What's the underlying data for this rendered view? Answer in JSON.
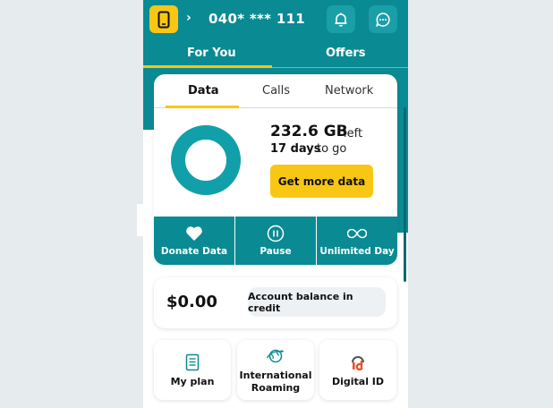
{
  "header": {
    "chevron": "›",
    "phone_number": "040* *** 111",
    "icons": [
      "phone-icon",
      "bell-icon",
      "chat-icon"
    ]
  },
  "main_tabs": [
    {
      "label": "For You",
      "active": true
    },
    {
      "label": "Offers",
      "active": false
    }
  ],
  "usage_tabs": [
    {
      "label": "Data",
      "active": true
    },
    {
      "label": "Calls",
      "active": false
    },
    {
      "label": "Network",
      "active": false
    }
  ],
  "usage": {
    "amount": "232.6 GB",
    "amount_suffix": "left",
    "days": "17 days",
    "days_suffix": "to go",
    "remaining_fraction": 1.0,
    "cta_label": "Get more data"
  },
  "actions": [
    {
      "label": "Donate Data",
      "icon": "heart-icon"
    },
    {
      "label": "Pause",
      "icon": "pause-icon"
    },
    {
      "label": "Unlimited Day",
      "icon": "infinity-icon"
    }
  ],
  "balance": {
    "amount": "$0.00",
    "label": "Account balance in credit"
  },
  "tiles": [
    {
      "label": "My plan",
      "icon": "document-icon"
    },
    {
      "label": "International Roaming",
      "icon": "globe-plane-icon"
    },
    {
      "label": "Digital ID",
      "icon": "digital-id-icon"
    }
  ],
  "colors": {
    "teal": "#0a8a93",
    "accent_yellow": "#f8c713",
    "background": "#e6ebee"
  }
}
